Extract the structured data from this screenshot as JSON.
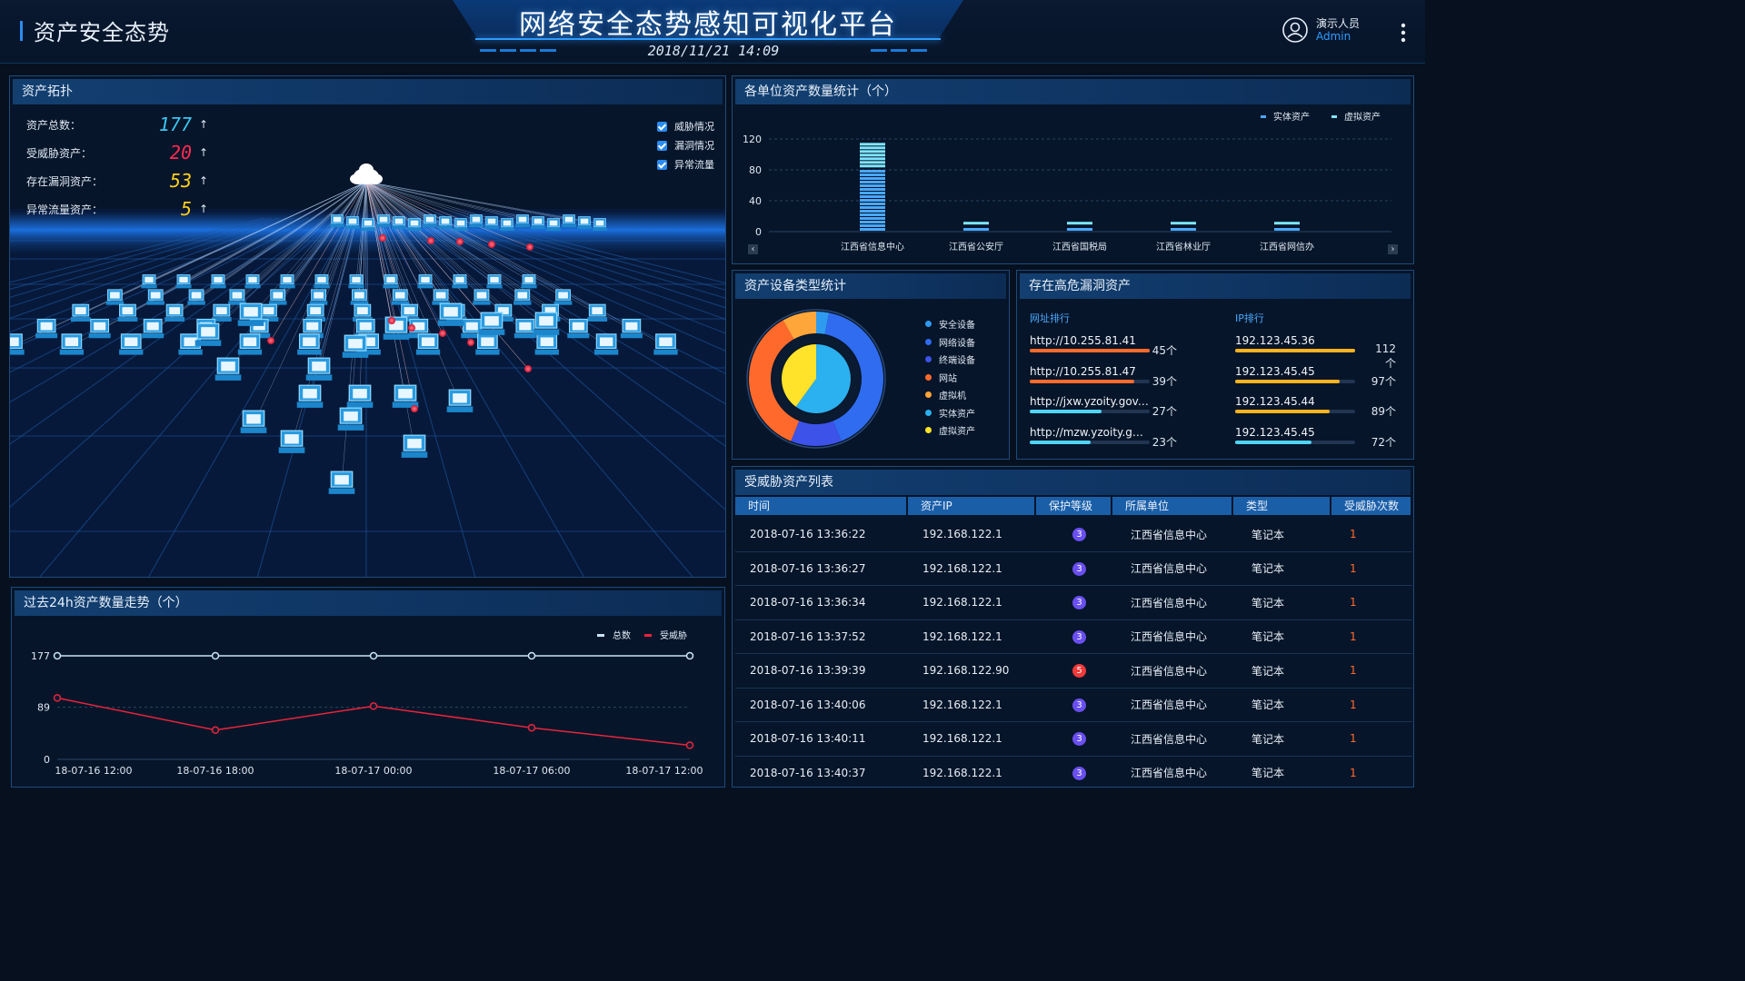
{
  "header": {
    "left_title": "资产安全态势",
    "main_title": "网络安全态势感知可视化平台",
    "datetime": "2018/11/21  14:09",
    "user_name": "演示人员",
    "user_role": "Admin"
  },
  "topology": {
    "title": "资产拓扑",
    "stats": [
      {
        "label": "资产总数：",
        "value": "177",
        "color": "#39c6f2"
      },
      {
        "label": "受威胁资产：",
        "value": "20",
        "color": "#ff2a52"
      },
      {
        "label": "存在漏洞资产：",
        "value": "53",
        "color": "#ffd21e"
      },
      {
        "label": "异常流量资产：",
        "value": "5",
        "color": "#ffd21e"
      }
    ],
    "up_arrow": "↑",
    "legend": [
      "威胁情况",
      "漏洞情况",
      "异常流量"
    ]
  },
  "trend": {
    "title": "过去24h资产数量走势（个）",
    "legend": [
      {
        "name": "总数",
        "color": "#c9e6f7"
      },
      {
        "name": "受威胁",
        "color": "#e8243c"
      }
    ]
  },
  "bar": {
    "title": "各单位资产数量统计（个）",
    "legend": [
      {
        "name": "实体资产",
        "color": "#4aa8ff"
      },
      {
        "name": "虚拟资产",
        "color": "#7ee6ff"
      }
    ],
    "nav_left": "‹",
    "nav_right": "›"
  },
  "pie": {
    "title": "资产设备类型统计",
    "legend": [
      {
        "name": "安全设备",
        "color": "#2f9bf0"
      },
      {
        "name": "网络设备",
        "color": "#2f6cf0"
      },
      {
        "name": "终端设备",
        "color": "#3c52e8"
      },
      {
        "name": "网站",
        "color": "#ff6a2c"
      },
      {
        "name": "虚拟机",
        "color": "#ffa63a"
      },
      {
        "name": "实体资产",
        "color": "#2bb0f0"
      },
      {
        "name": "虚拟资产",
        "color": "#ffe22a"
      }
    ]
  },
  "vuln": {
    "title": "存在高危漏洞资产",
    "col1_title": "网址排行",
    "col2_title": "IP排行",
    "urls": [
      {
        "name": "http://10.255.81.41",
        "count": "45个",
        "pct": 1.0
      },
      {
        "name": "http://10.255.81.47",
        "count": "39个",
        "pct": 0.87
      },
      {
        "name": "http://jxw.yzoity.gov.on",
        "count": "27个",
        "pct": 0.6
      },
      {
        "name": "http://mzw.yzoity.gov...",
        "count": "23个",
        "pct": 0.51
      }
    ],
    "ips": [
      {
        "name": "192.123.45.36",
        "count": "112个",
        "pct": 1.0
      },
      {
        "name": "192.123.45.45",
        "count": "97个",
        "pct": 0.87
      },
      {
        "name": "192.123.45.44",
        "count": "89个",
        "pct": 0.79
      },
      {
        "name": "192.123.45.45",
        "count": "72个",
        "pct": 0.64
      }
    ]
  },
  "threat_list": {
    "title": "受威胁资产列表",
    "columns": [
      "时间",
      "资产IP",
      "保护等级",
      "所属单位",
      "类型",
      "受威胁次数"
    ],
    "rows": [
      [
        "2018-07-16 13:36:22",
        "192.168.122.1",
        "3",
        "江西省信息中心",
        "笔记本",
        "1"
      ],
      [
        "2018-07-16 13:36:27",
        "192.168.122.1",
        "3",
        "江西省信息中心",
        "笔记本",
        "1"
      ],
      [
        "2018-07-16 13:36:34",
        "192.168.122.1",
        "3",
        "江西省信息中心",
        "笔记本",
        "1"
      ],
      [
        "2018-07-16 13:37:52",
        "192.168.122.1",
        "3",
        "江西省信息中心",
        "笔记本",
        "1"
      ],
      [
        "2018-07-16 13:39:39",
        "192.168.122.90",
        "5",
        "江西省信息中心",
        "笔记本",
        "1"
      ],
      [
        "2018-07-16 13:40:06",
        "192.168.122.1",
        "3",
        "江西省信息中心",
        "笔记本",
        "1"
      ],
      [
        "2018-07-16 13:40:11",
        "192.168.122.1",
        "3",
        "江西省信息中心",
        "笔记本",
        "1"
      ],
      [
        "2018-07-16 13:40:37",
        "192.168.122.1",
        "3",
        "江西省信息中心",
        "笔记本",
        "1"
      ]
    ],
    "level_colors": {
      "3": "#6a4ff0",
      "5": "#f03a3a"
    }
  },
  "chart_data": [
    {
      "type": "line",
      "title": "过去24h资产数量走势（个）",
      "x": [
        "18-07-16 12:00",
        "18-07-16 18:00",
        "18-07-17 00:00",
        "18-07-17 06:00",
        "18-07-17 12:00"
      ],
      "yticks": [
        0,
        89,
        177
      ],
      "ylim": [
        0,
        177
      ],
      "series": [
        {
          "name": "总数",
          "values": [
            177,
            177,
            177,
            177,
            177
          ],
          "color": "#c9e6f7"
        },
        {
          "name": "受威胁",
          "values": [
            105,
            50,
            91,
            54,
            24
          ],
          "color": "#e8243c"
        }
      ],
      "legend_position": "top-right",
      "grid": true
    },
    {
      "type": "bar",
      "title": "各单位资产数量统计（个）",
      "categories": [
        "江西省信息中心",
        "江西省公安厅",
        "江西省国税局",
        "江西省林业厅",
        "江西省网信办"
      ],
      "yticks": [
        0,
        40,
        80,
        120
      ],
      "ylim": [
        0,
        120
      ],
      "series": [
        {
          "name": "实体资产",
          "values": [
            82,
            8,
            8,
            8,
            8
          ],
          "color": "#4aa8ff"
        },
        {
          "name": "虚拟资产",
          "values": [
            35,
            6,
            6,
            6,
            6
          ],
          "color": "#7ee6ff"
        }
      ],
      "stacked": true,
      "legend_position": "top-right",
      "grid": true
    },
    {
      "type": "pie",
      "title": "资产设备类型统计",
      "rings": [
        {
          "name": "outer",
          "slices": [
            {
              "name": "安全设备",
              "value": 3
            },
            {
              "name": "网络设备",
              "value": 40
            },
            {
              "name": "终端设备",
              "value": 12
            },
            {
              "name": "网站",
              "value": 35
            },
            {
              "name": "虚拟机",
              "value": 8
            }
          ]
        },
        {
          "name": "inner",
          "slices": [
            {
              "name": "实体资产",
              "value": 60
            },
            {
              "name": "虚拟资产",
              "value": 40
            }
          ]
        }
      ]
    }
  ]
}
